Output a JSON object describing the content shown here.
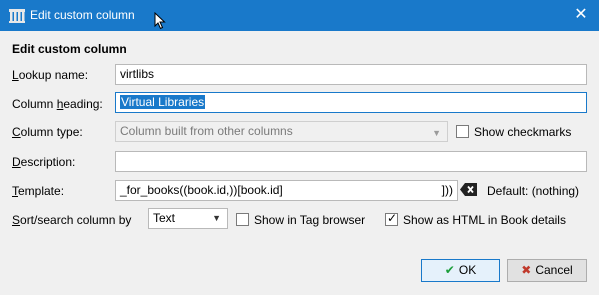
{
  "window": {
    "title": "Edit custom column",
    "close_glyph": "✕",
    "app_icon": "calibre-library-icon"
  },
  "dialog": {
    "heading": "Edit custom column",
    "lookup": {
      "label": "Lookup name:",
      "value": "virtlibs"
    },
    "column_heading": {
      "label": "Column heading:",
      "value": "Virtual Libraries"
    },
    "column_type": {
      "label": "Column type:",
      "value": "Column built from other columns"
    },
    "show_checkmarks": {
      "label": "Show checkmarks",
      "checked": false
    },
    "description": {
      "label": "Description:",
      "value": ""
    },
    "template": {
      "label": "Template:",
      "value": "_for_books((book.id,))[book.id]",
      "value_tail": "]))",
      "default_text": "Default: (nothing)"
    },
    "sort_search": {
      "label": "Sort/search column by",
      "value": "Text"
    },
    "show_in_tag_browser": {
      "label": "Show in Tag browser",
      "checked": false
    },
    "show_as_html": {
      "label": "Show as HTML in Book details",
      "checked": true
    },
    "ok_label": "OK",
    "cancel_label": "Cancel"
  },
  "colors": {
    "titlebar": "#1979ca",
    "selection": "#1979ca",
    "ok_icon": "#1a9e3a",
    "cancel_icon": "#c0392b"
  }
}
